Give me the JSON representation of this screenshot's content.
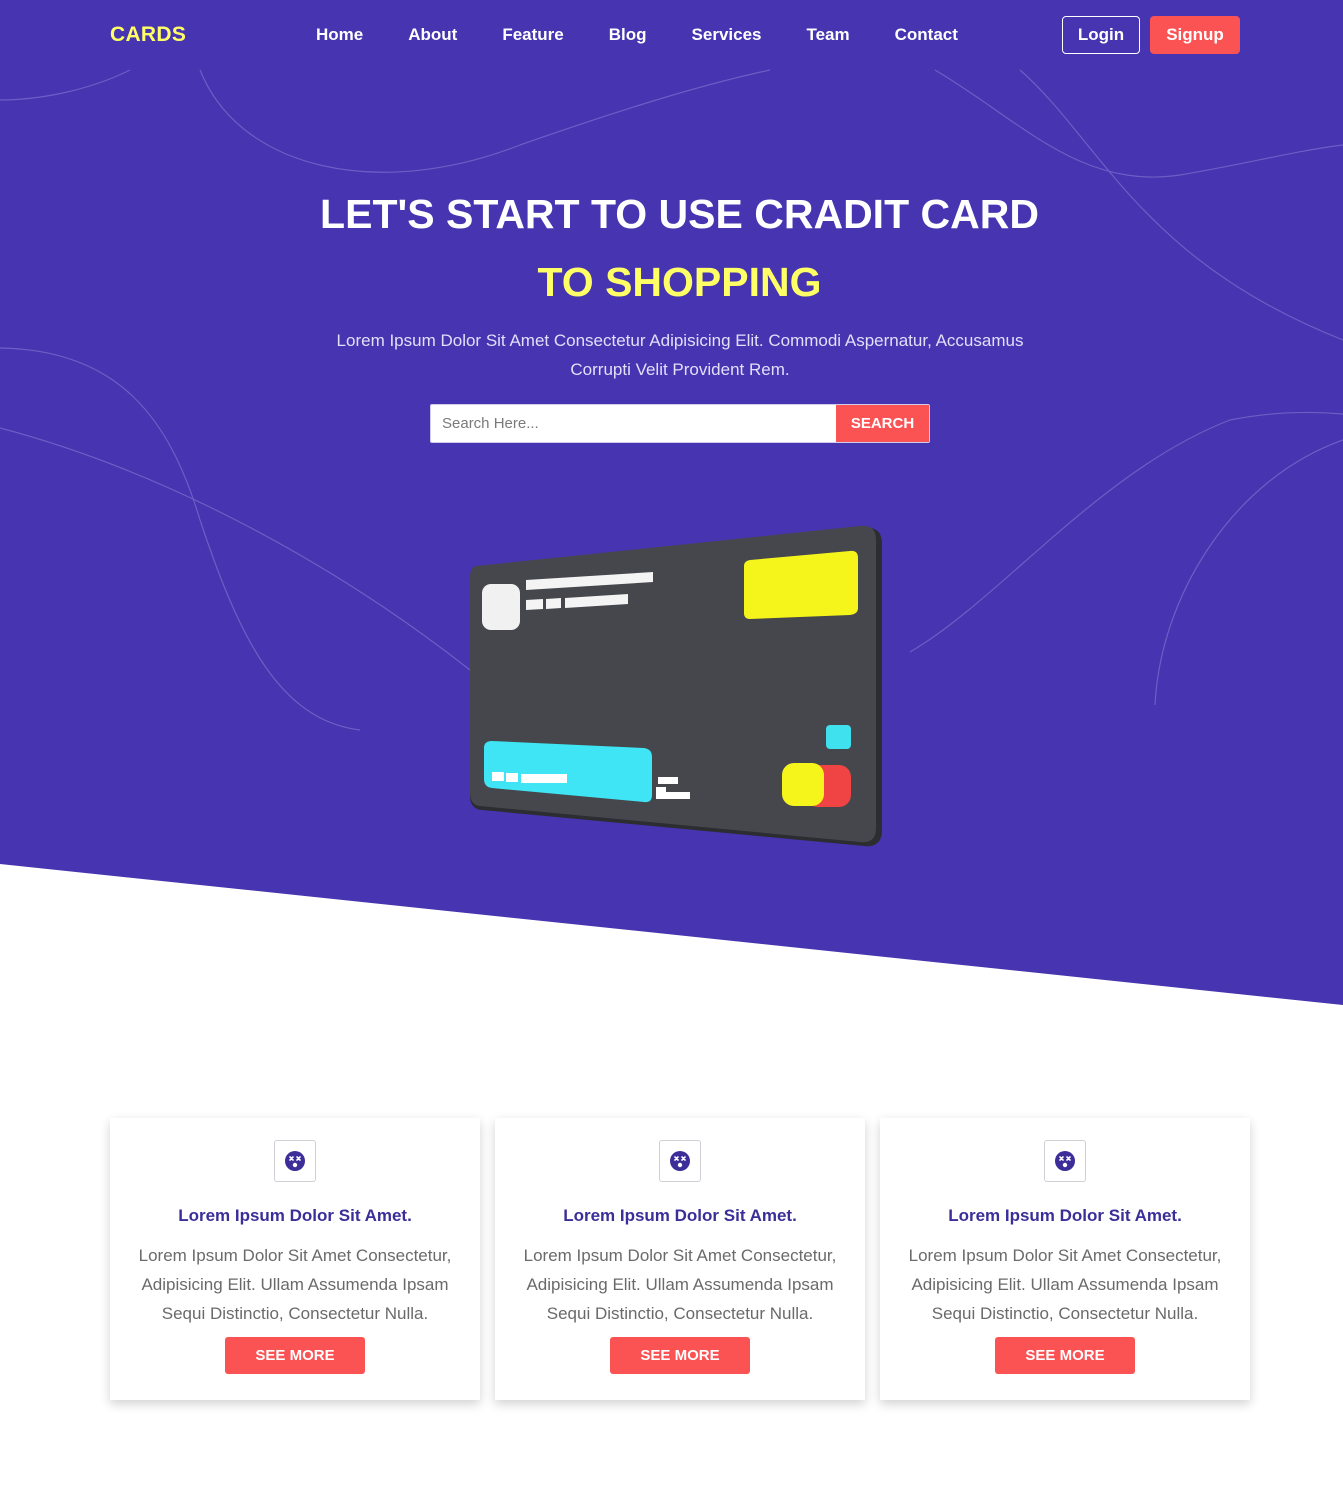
{
  "brand": {
    "logo": "CARDS"
  },
  "nav": {
    "items": [
      {
        "label": "Home"
      },
      {
        "label": "About"
      },
      {
        "label": "Feature"
      },
      {
        "label": "Blog"
      },
      {
        "label": "Services"
      },
      {
        "label": "Team"
      },
      {
        "label": "Contact"
      }
    ],
    "login_label": "Login",
    "signup_label": "Signup"
  },
  "hero": {
    "title": "LET'S START TO USE CRADIT CARD",
    "subtitle": "TO SHOPPING",
    "description": "Lorem Ipsum Dolor Sit Amet Consectetur Adipisicing Elit. Commodi Aspernatur, Accusamus Corrupti Velit Provident Rem.",
    "search_placeholder": "Search Here...",
    "search_button": "SEARCH"
  },
  "features": [
    {
      "icon": "dizzy-face-icon",
      "title": "Lorem Ipsum Dolor Sit Amet.",
      "text": "Lorem Ipsum Dolor Sit Amet Consectetur, Adipisicing Elit. Ullam Assumenda Ipsam Sequi Distinctio, Consectetur Nulla.",
      "button": "SEE MORE"
    },
    {
      "icon": "dizzy-face-icon",
      "title": "Lorem Ipsum Dolor Sit Amet.",
      "text": "Lorem Ipsum Dolor Sit Amet Consectetur, Adipisicing Elit. Ullam Assumenda Ipsam Sequi Distinctio, Consectetur Nulla.",
      "button": "SEE MORE"
    },
    {
      "icon": "dizzy-face-icon",
      "title": "Lorem Ipsum Dolor Sit Amet.",
      "text": "Lorem Ipsum Dolor Sit Amet Consectetur, Adipisicing Elit. Ullam Assumenda Ipsam Sequi Distinctio, Consectetur Nulla.",
      "button": "SEE MORE"
    }
  ],
  "colors": {
    "hero_bg": "#4634b0",
    "accent_yellow": "#ffff66",
    "accent_red": "#fb5254",
    "title_purple": "#3b2e99"
  }
}
